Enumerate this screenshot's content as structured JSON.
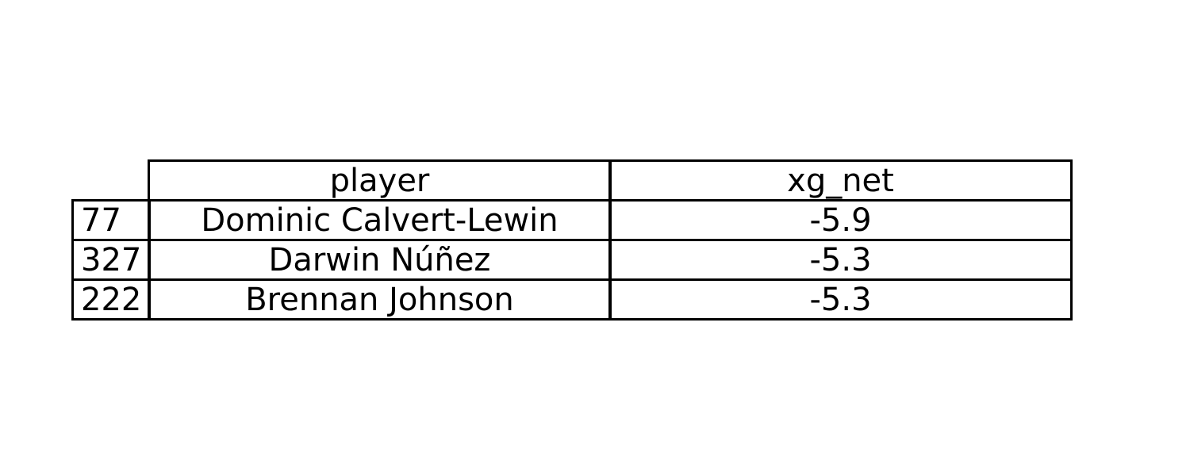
{
  "chart_data": {
    "type": "table",
    "columns": [
      "player",
      "xg_net"
    ],
    "rows": [
      {
        "index": "77",
        "player": "Dominic Calvert-Lewin",
        "xg_net": "-5.9"
      },
      {
        "index": "327",
        "player": "Darwin Núñez",
        "xg_net": "-5.3"
      },
      {
        "index": "222",
        "player": "Brennan Johnson",
        "xg_net": "-5.3"
      }
    ]
  }
}
